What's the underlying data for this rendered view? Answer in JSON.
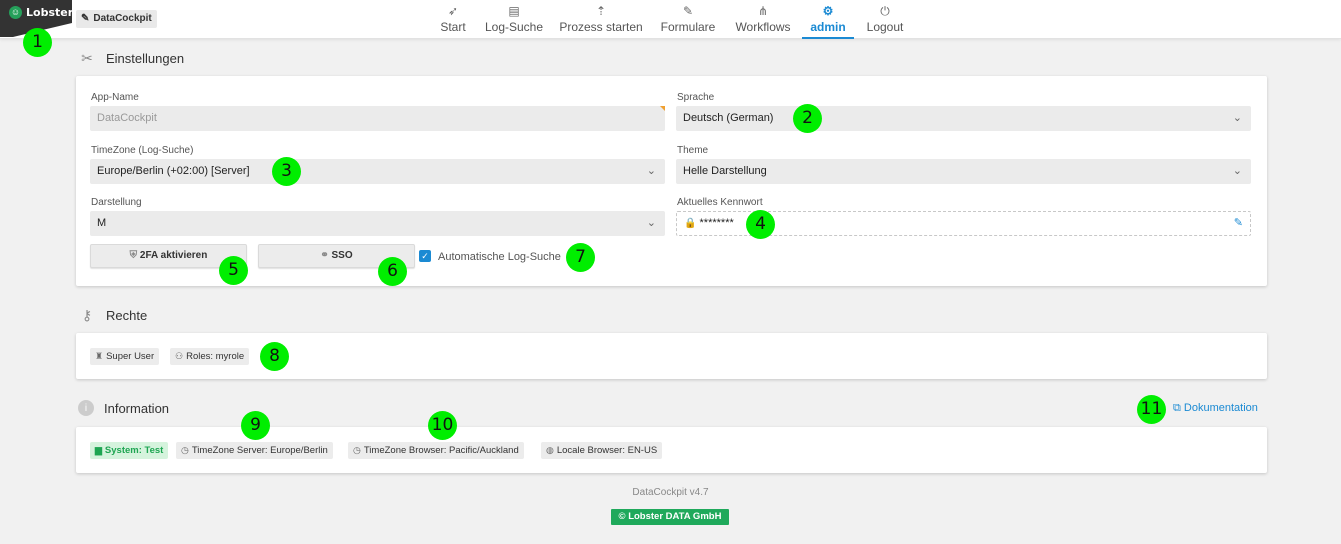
{
  "brand": {
    "logo_text": "Lobster",
    "app_chip": "DataCockpit"
  },
  "nav": [
    {
      "label": "Start",
      "icon": "rocket-icon",
      "glyph": "🚀"
    },
    {
      "label": "Log-Suche",
      "icon": "log-file-icon",
      "glyph": "🗎"
    },
    {
      "label": "Prozess starten",
      "icon": "upload-icon",
      "glyph": "⇪"
    },
    {
      "label": "Formulare",
      "icon": "edit-icon",
      "glyph": "✎"
    },
    {
      "label": "Workflows",
      "icon": "workflow-icon",
      "glyph": "⚬"
    },
    {
      "label": "admin",
      "icon": "user-gear-icon",
      "glyph": "👤",
      "active": true
    },
    {
      "label": "Logout",
      "icon": "power-icon",
      "glyph": "⏻"
    }
  ],
  "markers": [
    "1",
    "2",
    "3",
    "4",
    "5",
    "6",
    "7",
    "8",
    "9",
    "10",
    "11"
  ],
  "settings": {
    "title": "Einstellungen",
    "app_name_label": "App-Name",
    "app_name_value": "DataCockpit",
    "language_label": "Sprache",
    "language_value": "Deutsch (German)",
    "timezone_label": "TimeZone (Log-Suche)",
    "timezone_value": "Europe/Berlin (+02:00) [Server]",
    "theme_label": "Theme",
    "theme_value": "Helle Darstellung",
    "display_label": "Darstellung",
    "display_value": "M",
    "password_label": "Aktuelles Kennwort",
    "password_value": "********",
    "twofa_button": "2FA aktivieren",
    "sso_button": "SSO",
    "auto_log_search_label": "Automatische Log-Suche",
    "auto_log_search_checked": true
  },
  "rights": {
    "title": "Rechte",
    "tags": [
      "Super User",
      "Roles: myrole"
    ]
  },
  "information": {
    "title": "Information",
    "doc_link": "Dokumentation",
    "tags": [
      "System: Test",
      "TimeZone Server: Europe/Berlin",
      "TimeZone Browser: Pacific/Auckland",
      "Locale Browser: EN-US"
    ]
  },
  "footer": {
    "version": "DataCockpit v4.7",
    "company": "Lobster DATA GmbH"
  },
  "colors": {
    "accent": "#1b8ad3",
    "marker": "#00ee00",
    "brand_green": "#1fa95b"
  }
}
